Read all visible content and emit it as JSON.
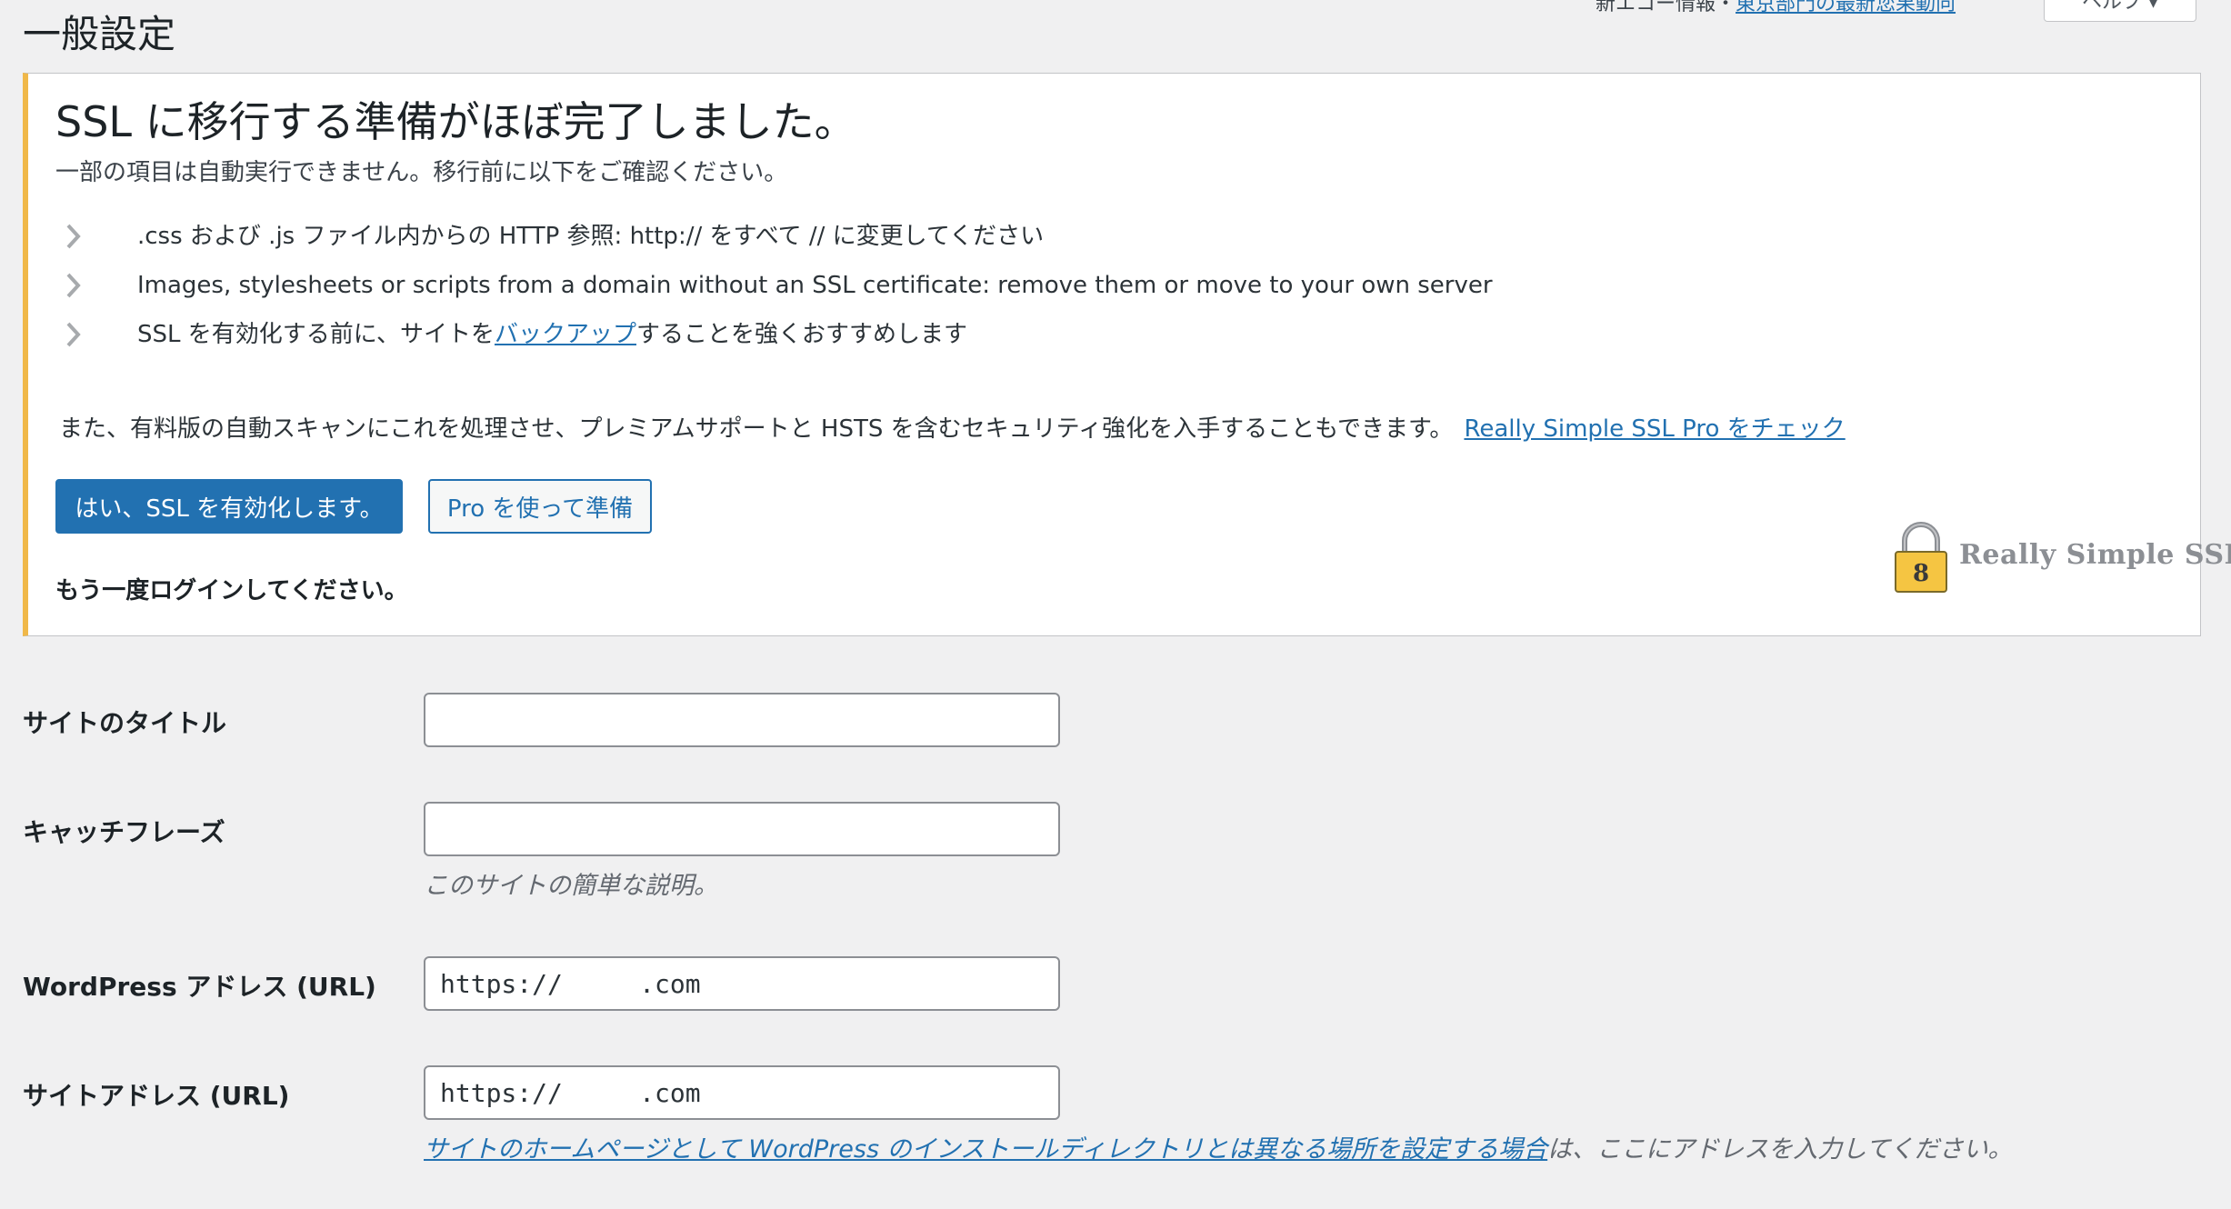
{
  "header": {
    "top_prefix": "新エコー情報・",
    "top_link": "東京部門の最新您果動向",
    "help_tab": "ヘルプ ▾"
  },
  "page_title": "一般設定",
  "notice": {
    "title": "SSL に移行する準備がほぼ完了しました。",
    "subtitle": "一部の項目は自動実行できません。移行前に以下をご確認ください。",
    "items": [
      {
        "text": ".css および .js ファイル内からの HTTP 参照: http:// をすべて // に変更してください"
      },
      {
        "text": "Images, stylesheets or scripts from a domain without an SSL certificate: remove them or move to your own server"
      },
      {
        "before": "SSL を有効化する前に、サイトを",
        "link": "バックアップ",
        "after": "することを強くおすすめします"
      }
    ],
    "pro_text": "また、有料版の自動スキャンにこれを処理させ、プレミアムサポートと HSTS を含むセキュリティ強化を入手することもできます。",
    "pro_link": "Really Simple SSL Pro をチェック",
    "primary_button": "はい、SSL を有効化します。",
    "secondary_button": "Pro を使って準備",
    "relogin": "もう一度ログインしてください。",
    "logo_text": "Really Simple SSL",
    "logo_digit": "8",
    "accent_color": "#f0b849",
    "icons": {
      "item_marker": "chevron-right-icon",
      "logo": "padlock-icon"
    }
  },
  "form": {
    "site_title": {
      "label": "サイトのタイトル",
      "value": ""
    },
    "tagline": {
      "label": "キャッチフレーズ",
      "value": "",
      "description": "このサイトの簡単な説明。"
    },
    "wp_url": {
      "label": "WordPress アドレス (URL)",
      "value": "https://     .com"
    },
    "site_url": {
      "label": "サイトアドレス (URL)",
      "value": "https://     .com",
      "desc_link": "サイトのホームページとして WordPress のインストールディレクトリとは異なる場所を設定する場合",
      "desc_after": "は、ここにアドレスを入力してください。"
    }
  },
  "colors": {
    "primary": "#2271b1",
    "background": "#f0f0f1",
    "notice_border": "#f0b849"
  }
}
